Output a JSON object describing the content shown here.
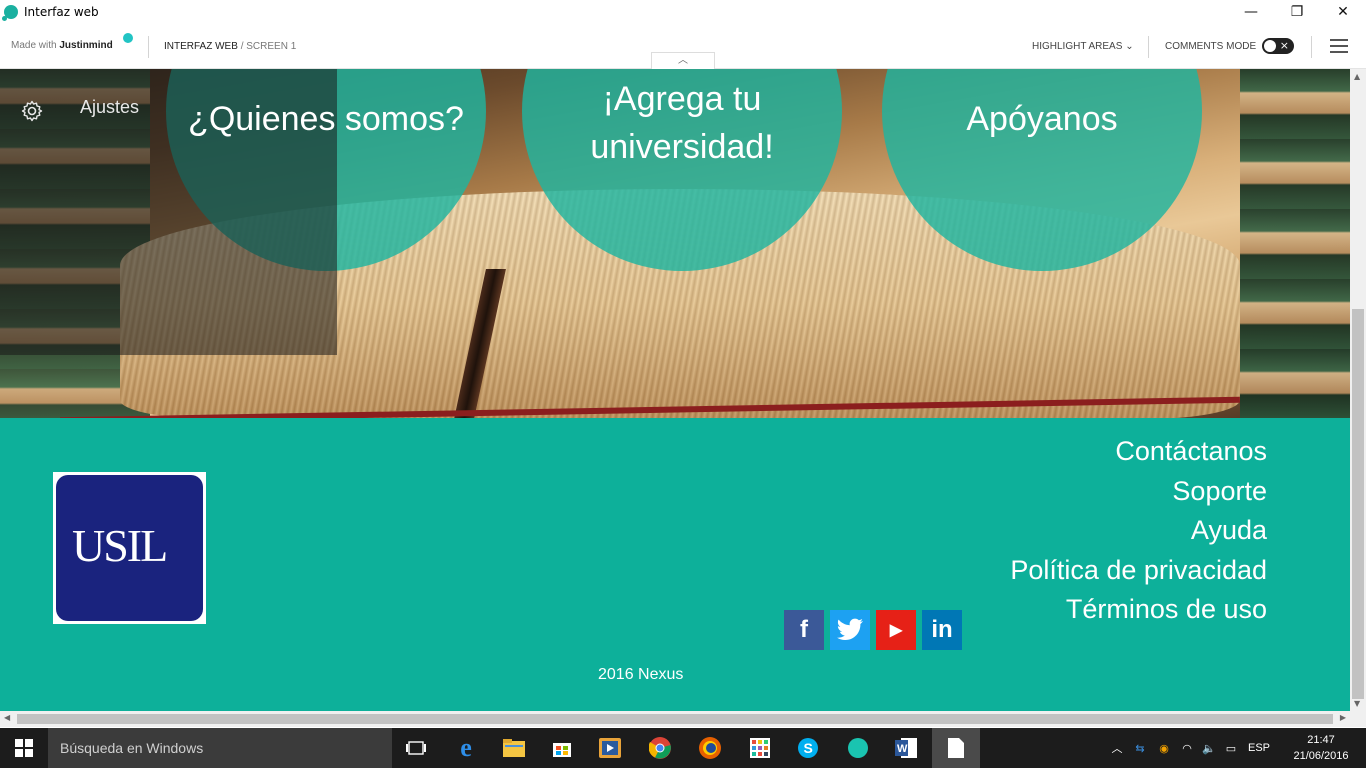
{
  "window": {
    "title": "Interfaz web",
    "controls": {
      "minimize": "—",
      "restore": "❐",
      "close": "✕"
    }
  },
  "toolbar": {
    "made_with_prefix": "Made with",
    "made_with_brand": "Justinmind",
    "screen_path_main": "INTERFAZ WEB",
    "screen_path_sub": "/ SCREEN 1",
    "highlight_areas": "HIGHLIGHT AREAS",
    "comments_mode": "COMMENTS MODE",
    "collapse_arrow": "︿"
  },
  "nav": {
    "settings_label": "Ajustes",
    "circles": [
      {
        "label_line1": "¿Quienes somos?",
        "label_line2": ""
      },
      {
        "label_line1": "¡Agrega tu",
        "label_line2": "universidad!"
      },
      {
        "label_line1": "Apóyanos",
        "label_line2": ""
      }
    ]
  },
  "footer": {
    "logo_text": "USIL",
    "links": [
      "Contáctanos",
      "Soporte",
      "Ayuda",
      "Política de privacidad",
      "Términos de uso"
    ],
    "social": [
      {
        "name": "facebook-icon",
        "glyph": "f",
        "color": "#3b5998"
      },
      {
        "name": "twitter-icon",
        "glyph": "🐦",
        "color": "#1da1f2"
      },
      {
        "name": "youtube-icon",
        "glyph": "▶",
        "color": "#e62117"
      },
      {
        "name": "linkedin-icon",
        "glyph": "in",
        "color": "#0077b5"
      }
    ],
    "copyright": "2016 Nexus",
    "accent": "#0db09a"
  },
  "taskbar": {
    "search_placeholder": "Búsqueda en Windows",
    "language": "ESP",
    "time": "21:47",
    "date": "21/06/2016"
  }
}
